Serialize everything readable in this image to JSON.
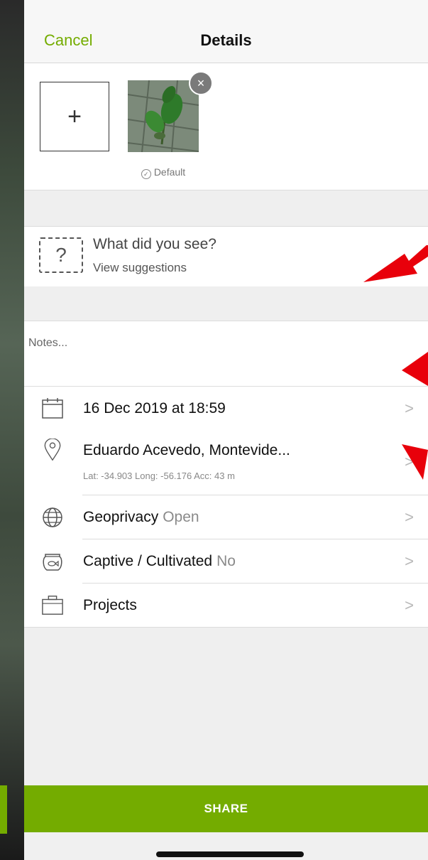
{
  "navbar": {
    "cancel_label": "Cancel",
    "title": "Details"
  },
  "photos": {
    "add_label": "+",
    "default_label": "Default",
    "remove_label": "×"
  },
  "species": {
    "question": "What did you see?",
    "suggestions_label": "View suggestions",
    "icon": "question-mark-dashed-icon"
  },
  "notes": {
    "placeholder": "Notes..."
  },
  "rows": {
    "date": {
      "label": "16 Dec 2019 at 18:59",
      "icon": "calendar-icon"
    },
    "location": {
      "label": "Eduardo Acevedo, Montevide...",
      "details": "Lat: -34.903  Long: -56.176  Acc: 43 m",
      "icon": "location-pin-icon"
    },
    "geoprivacy": {
      "label": "Geoprivacy",
      "value": "Open",
      "icon": "globe-icon"
    },
    "captive": {
      "label": "Captive / Cultivated",
      "value": "No",
      "icon": "fishbowl-icon"
    },
    "projects": {
      "label": "Projects",
      "icon": "briefcase-icon"
    }
  },
  "chevron": ">",
  "share": {
    "label": "SHARE"
  },
  "colors": {
    "accent": "#74ac00",
    "annotation_arrow": "#e8000b"
  }
}
